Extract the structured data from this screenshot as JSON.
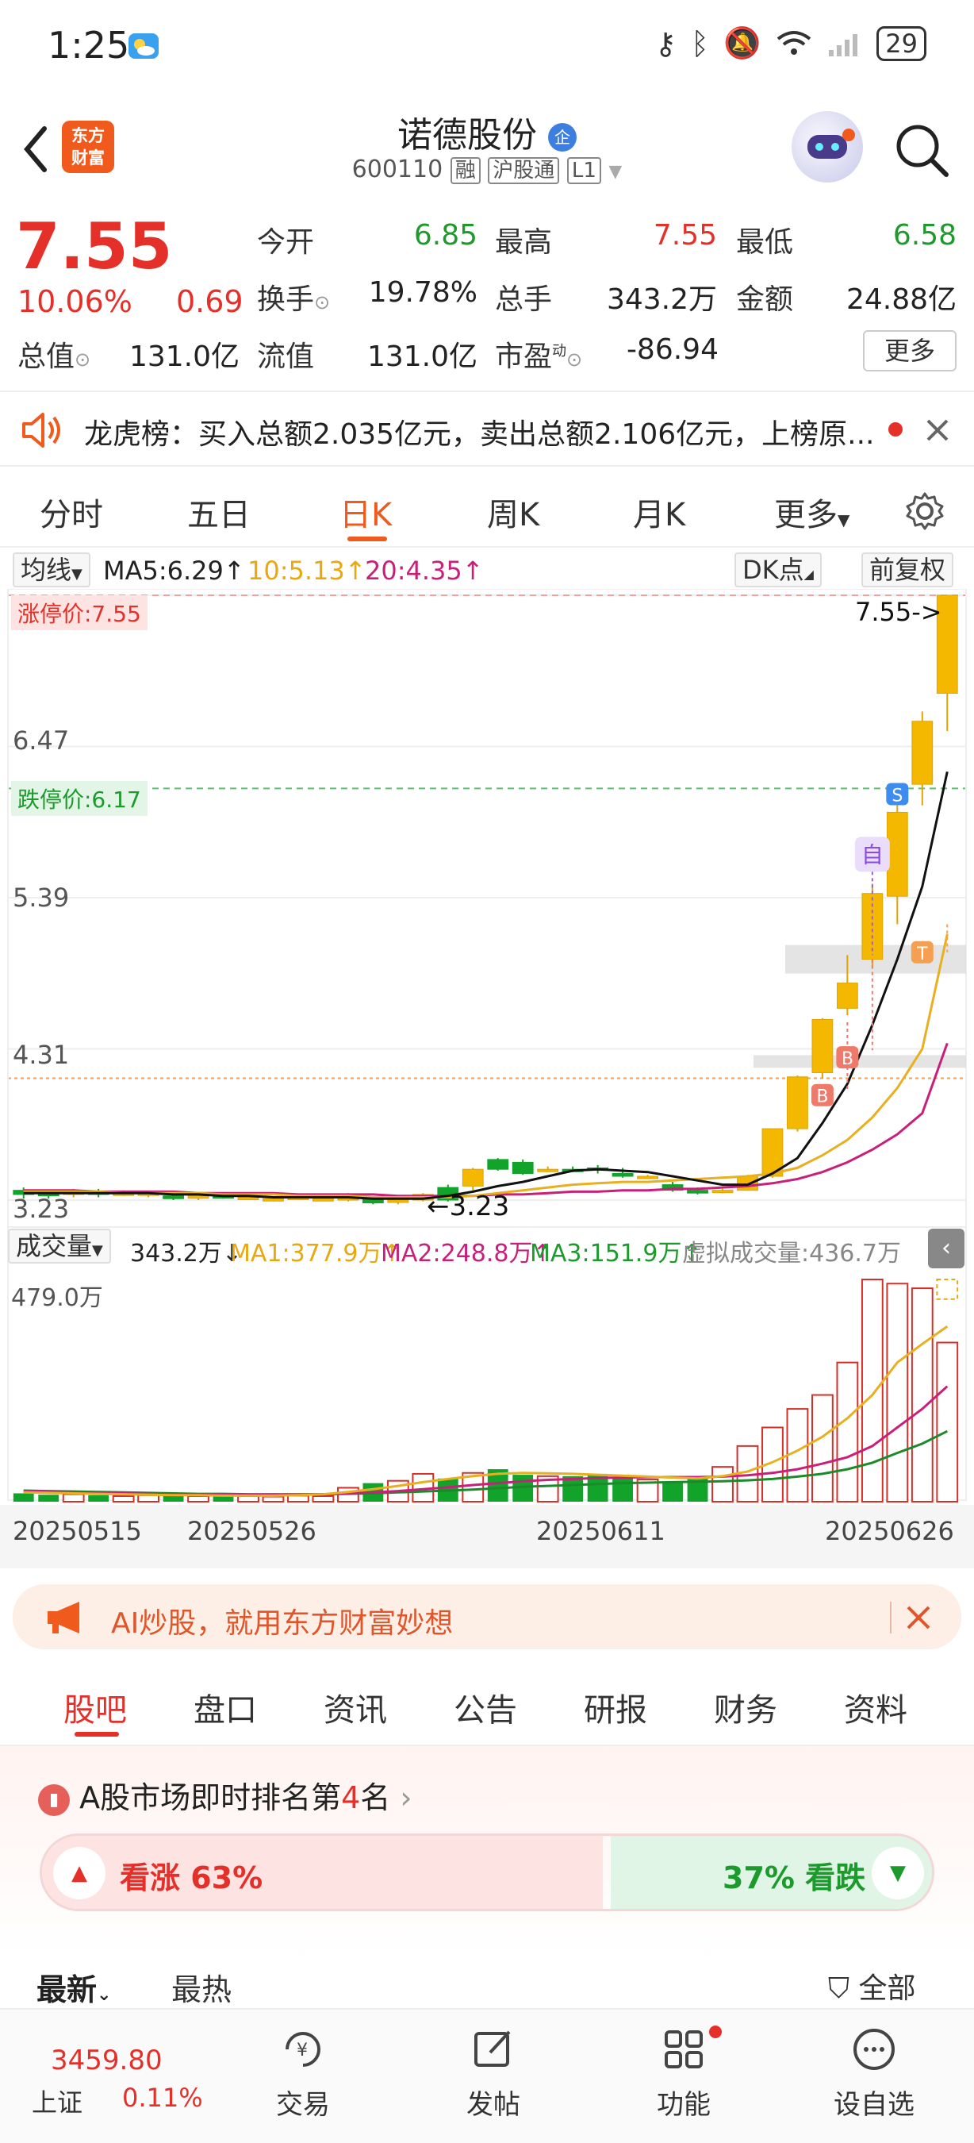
{
  "status": {
    "time": "1:25",
    "battery": "29"
  },
  "header": {
    "title": "诺德股份",
    "badge": "企",
    "code": "600110",
    "tag_rong": "融",
    "tag_market": "沪股通",
    "tag_level": "L1",
    "logo_line1": "东方",
    "logo_line2": "财富"
  },
  "quote": {
    "price": "7.55",
    "change_pct": "10.06%",
    "change_amt": "0.69",
    "open_label": "今开",
    "open": "6.85",
    "high_label": "最高",
    "high": "7.55",
    "low_label": "最低",
    "low": "6.58",
    "turnover_label": "换手",
    "turnover": "19.78%",
    "volume_label": "总手",
    "volume": "343.2万",
    "amount_label": "金额",
    "amount": "24.88亿",
    "mktcap_label": "总值",
    "mktcap": "131.0亿",
    "float_label": "流值",
    "float": "131.0亿",
    "pe_label": "市盈",
    "pe_sup": "动",
    "pe": "-86.94",
    "more": "更多"
  },
  "dragon_tiger": {
    "text": "龙虎榜：买入总额2.035亿元，卖出总额2.106亿元，上榜原..."
  },
  "period_tabs": [
    "分时",
    "五日",
    "日K",
    "周K",
    "月K",
    "更多"
  ],
  "ma": {
    "selector": "均线",
    "ma5": "MA5:6.29↑",
    "ma10": "10:5.13↑",
    "ma20": "20:4.35↑",
    "dk": "DK点",
    "adjust": "前复权"
  },
  "chart_labels": {
    "limit_up": "涨停价:7.55",
    "limit_down": "跌停价:6.17",
    "last_price": "7.55->",
    "min_price": "3.23",
    "y_ticks": [
      "6.47",
      "5.39",
      "4.31",
      "3.23"
    ],
    "marker_b": "B",
    "marker_s": "S",
    "marker_t": "T",
    "marker_zi": "自"
  },
  "volume_bar": {
    "selector": "成交量",
    "value": "343.2万↓",
    "ma1": "MA1:377.9万↑",
    "ma2": "MA2:248.8万↑",
    "ma3": "MA3:151.9万↑",
    "virtual": "虚拟成交量:436.7万",
    "max": "479.0万"
  },
  "x_dates": [
    "20250515",
    "20250526",
    "20250611",
    "20250626"
  ],
  "ai_banner": {
    "text": "AI炒股，就用东方财富妙想"
  },
  "content_tabs": [
    "股吧",
    "盘口",
    "资讯",
    "公告",
    "研报",
    "财务",
    "资料"
  ],
  "ranking": {
    "prefix": "A股市场即时排名第",
    "rank": "4",
    "suffix": "名"
  },
  "sentiment": {
    "rise": "看涨 63%",
    "fall": "37% 看跌",
    "rise_pct": 63
  },
  "sort": {
    "latest": "最新",
    "hot": "最热",
    "filter": "全部"
  },
  "bottom_nav": {
    "index_value": "3459.80",
    "index_name": "上证",
    "index_change": "0.11%",
    "trade": "交易",
    "post": "发帖",
    "function": "功能",
    "watchlist": "设自选"
  },
  "chart_data": {
    "type": "candlestick",
    "title": "",
    "ylim": [
      3.23,
      7.55
    ],
    "candles": [
      {
        "o": 3.3,
        "c": 3.27,
        "h": 3.32,
        "l": 3.24
      },
      {
        "o": 3.28,
        "c": 3.26,
        "h": 3.3,
        "l": 3.24
      },
      {
        "o": 3.27,
        "c": 3.29,
        "h": 3.31,
        "l": 3.25
      },
      {
        "o": 3.29,
        "c": 3.27,
        "h": 3.31,
        "l": 3.25
      },
      {
        "o": 3.28,
        "c": 3.28,
        "h": 3.3,
        "l": 3.26
      },
      {
        "o": 3.27,
        "c": 3.28,
        "h": 3.29,
        "l": 3.25
      },
      {
        "o": 3.26,
        "c": 3.24,
        "h": 3.28,
        "l": 3.23
      },
      {
        "o": 3.25,
        "c": 3.26,
        "h": 3.27,
        "l": 3.23
      },
      {
        "o": 3.26,
        "c": 3.25,
        "h": 3.27,
        "l": 3.24
      },
      {
        "o": 3.25,
        "c": 3.25,
        "h": 3.26,
        "l": 3.23
      },
      {
        "o": 3.23,
        "c": 3.24,
        "h": 3.25,
        "l": 3.22
      },
      {
        "o": 3.24,
        "c": 3.25,
        "h": 3.26,
        "l": 3.23
      },
      {
        "o": 3.24,
        "c": 3.24,
        "h": 3.25,
        "l": 3.23
      },
      {
        "o": 3.23,
        "c": 3.27,
        "h": 3.28,
        "l": 3.22
      },
      {
        "o": 3.24,
        "c": 3.21,
        "h": 3.25,
        "l": 3.2
      },
      {
        "o": 3.22,
        "c": 3.23,
        "h": 3.23,
        "l": 3.2
      },
      {
        "o": 3.23,
        "c": 3.27,
        "h": 3.28,
        "l": 3.22
      },
      {
        "o": 3.32,
        "c": 3.23,
        "h": 3.34,
        "l": 3.22
      },
      {
        "o": 3.33,
        "c": 3.45,
        "h": 3.46,
        "l": 3.3
      },
      {
        "o": 3.52,
        "c": 3.45,
        "h": 3.53,
        "l": 3.44
      },
      {
        "o": 3.5,
        "c": 3.42,
        "h": 3.52,
        "l": 3.41
      },
      {
        "o": 3.44,
        "c": 3.45,
        "h": 3.47,
        "l": 3.43
      },
      {
        "o": 3.45,
        "c": 3.44,
        "h": 3.47,
        "l": 3.43
      },
      {
        "o": 3.46,
        "c": 3.45,
        "h": 3.48,
        "l": 3.42
      },
      {
        "o": 3.42,
        "c": 3.4,
        "h": 3.46,
        "l": 3.39
      },
      {
        "o": 3.39,
        "c": 3.4,
        "h": 3.41,
        "l": 3.38
      },
      {
        "o": 3.34,
        "c": 3.3,
        "h": 3.36,
        "l": 3.29
      },
      {
        "o": 3.3,
        "c": 3.28,
        "h": 3.32,
        "l": 3.27
      },
      {
        "o": 3.29,
        "c": 3.3,
        "h": 3.31,
        "l": 3.28
      },
      {
        "o": 3.3,
        "c": 3.4,
        "h": 3.41,
        "l": 3.3
      },
      {
        "o": 3.4,
        "c": 3.74,
        "h": 3.74,
        "l": 3.39
      },
      {
        "o": 3.74,
        "c": 4.11,
        "h": 4.12,
        "l": 3.72
      },
      {
        "o": 4.14,
        "c": 4.52,
        "h": 4.53,
        "l": 4.1
      },
      {
        "o": 4.6,
        "c": 4.78,
        "h": 4.98,
        "l": 4.55
      },
      {
        "o": 4.95,
        "c": 5.42,
        "h": 5.49,
        "l": 4.9
      },
      {
        "o": 5.4,
        "c": 6.0,
        "h": 6.05,
        "l": 5.2
      },
      {
        "o": 6.2,
        "c": 6.65,
        "h": 6.72,
        "l": 6.05
      },
      {
        "o": 6.85,
        "c": 7.55,
        "h": 7.55,
        "l": 6.58
      }
    ],
    "ma5": [
      3.28,
      3.28,
      3.28,
      3.28,
      3.28,
      3.28,
      3.27,
      3.27,
      3.26,
      3.26,
      3.25,
      3.25,
      3.25,
      3.25,
      3.24,
      3.24,
      3.24,
      3.26,
      3.29,
      3.33,
      3.36,
      3.4,
      3.44,
      3.45,
      3.44,
      3.43,
      3.4,
      3.37,
      3.34,
      3.34,
      3.42,
      3.53,
      3.78,
      4.06,
      4.48,
      4.95,
      5.47,
      6.29
    ],
    "ma10": [
      3.29,
      3.29,
      3.29,
      3.29,
      3.28,
      3.28,
      3.28,
      3.28,
      3.27,
      3.27,
      3.27,
      3.26,
      3.26,
      3.26,
      3.25,
      3.25,
      3.25,
      3.25,
      3.26,
      3.28,
      3.3,
      3.32,
      3.34,
      3.35,
      3.36,
      3.36,
      3.37,
      3.38,
      3.39,
      3.4,
      3.42,
      3.46,
      3.55,
      3.66,
      3.82,
      4.03,
      4.31,
      5.13
    ],
    "ma20": [
      3.3,
      3.3,
      3.3,
      3.29,
      3.29,
      3.29,
      3.29,
      3.28,
      3.28,
      3.28,
      3.28,
      3.27,
      3.27,
      3.27,
      3.27,
      3.26,
      3.26,
      3.26,
      3.26,
      3.27,
      3.27,
      3.28,
      3.29,
      3.29,
      3.3,
      3.3,
      3.31,
      3.31,
      3.32,
      3.33,
      3.35,
      3.38,
      3.43,
      3.5,
      3.59,
      3.7,
      3.85,
      4.35
    ],
    "volume": [
      18,
      15,
      16,
      14,
      12,
      14,
      13,
      12,
      14,
      12,
      11,
      13,
      12,
      30,
      40,
      45,
      60,
      50,
      62,
      70,
      58,
      55,
      55,
      60,
      52,
      48,
      42,
      55,
      75,
      120,
      160,
      200,
      230,
      300,
      479,
      470,
      460,
      343
    ],
    "volume_ma1": [
      20,
      19,
      18,
      17,
      16,
      15,
      14,
      14,
      13,
      13,
      13,
      14,
      16,
      21,
      27,
      34,
      42,
      49,
      55,
      60,
      62,
      61,
      60,
      58,
      56,
      54,
      52,
      50,
      55,
      65,
      85,
      110,
      140,
      180,
      230,
      300,
      340,
      377.9
    ],
    "volume_ma2": [
      22,
      21,
      20,
      19,
      18,
      17,
      16,
      15,
      15,
      15,
      15,
      15,
      16,
      18,
      20,
      23,
      27,
      31,
      36,
      40,
      44,
      47,
      49,
      51,
      52,
      53,
      53,
      53,
      54,
      57,
      62,
      70,
      82,
      96,
      120,
      160,
      200,
      248.8
    ],
    "volume_ma3": [
      24,
      23,
      22,
      21,
      20,
      19,
      18,
      17,
      17,
      16,
      16,
      16,
      16,
      17,
      18,
      20,
      22,
      24,
      26,
      29,
      32,
      34,
      36,
      38,
      40,
      41,
      42,
      43,
      44,
      46,
      49,
      54,
      60,
      70,
      84,
      105,
      125,
      151.9
    ]
  }
}
